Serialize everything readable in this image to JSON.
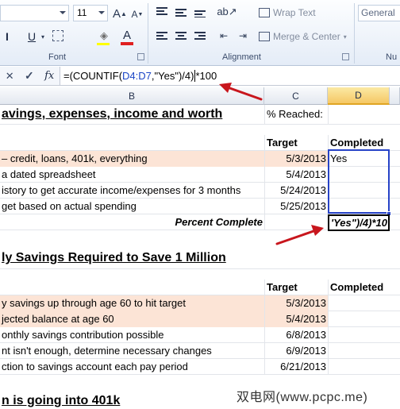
{
  "ribbon": {
    "font_size": "11",
    "wrap_text_label": "Wrap Text",
    "merge_center_label": "Merge & Center",
    "number_format": "General",
    "groups": {
      "font": "Font",
      "alignment": "Alignment",
      "number": "Nu"
    },
    "icons": [
      "grow-font-icon",
      "shrink-font-icon",
      "bold-icon",
      "italic-icon",
      "underline-icon",
      "borders-icon",
      "fill-color-icon",
      "font-color-icon",
      "align-top-icon",
      "align-middle-icon",
      "align-bottom-icon",
      "orientation-icon",
      "align-left-icon",
      "center-icon",
      "align-right-icon",
      "decrease-indent-icon",
      "increase-indent-icon"
    ]
  },
  "formula_bar": {
    "cancel": "✕",
    "enter": "✓",
    "fx": "fx",
    "formula_prefix": "=(COUNTIF(",
    "formula_ref": "D4:D7",
    "formula_middle": ",\"Yes\")/4)",
    "formula_suffix": "*100"
  },
  "columns": [
    "B",
    "C",
    "D"
  ],
  "rows": {
    "r1": {
      "b": "avings, expenses, income and worth",
      "c": "% Reached:"
    },
    "r3": {
      "c": "Target",
      "d": "Completed"
    },
    "r4": {
      "b": "– credit, loans, 401k, everything",
      "c": "5/3/2013",
      "d": "Yes"
    },
    "r5": {
      "b": "a dated spreadsheet",
      "c": "5/4/2013"
    },
    "r6": {
      "b": "istory to get accurate income/expenses for 3 months",
      "c": "5/24/2013"
    },
    "r7": {
      "b": "get based on actual spending",
      "c": "5/25/2013"
    },
    "r8": {
      "b": "Percent Complete",
      "d": "'Yes\")/4)*10"
    },
    "r10": {
      "b": "ly Savings Required to Save 1 Million"
    },
    "r12": {
      "c": "Target",
      "d": "Completed"
    },
    "r13": {
      "b": "y savings up through age 60 to hit target",
      "c": "5/3/2013"
    },
    "r14": {
      "b": "jected balance at age 60",
      "c": "5/4/2013"
    },
    "r15": {
      "b": "onthly savings contribution possible",
      "c": "6/8/2013"
    },
    "r16": {
      "b": "nt isn't enough, determine necessary changes",
      "c": "6/9/2013"
    },
    "r17": {
      "b": "ction to savings account each pay period",
      "c": "6/21/2013"
    },
    "r19": {
      "b": "n is going into 401k"
    }
  },
  "watermark": "双电网(www.pcpc.me)",
  "colors": {
    "peach": "#fce4d6",
    "selection": "#2743c7",
    "arrow": "#c8161d",
    "ref_blue": "#1a45c6"
  }
}
